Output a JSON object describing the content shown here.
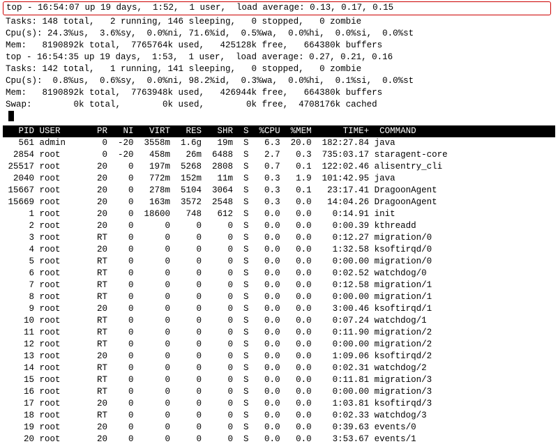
{
  "summary1": {
    "top_line": "top - 16:54:07 up 19 days,  1:52,  1 user,  load average: 0.13, 0.17, 0.15",
    "tasks": "Tasks: 148 total,   2 running, 146 sleeping,   0 stopped,   0 zombie",
    "cpu": "Cpu(s): 24.3%us,  3.6%sy,  0.0%ni, 71.6%id,  0.5%wa,  0.0%hi,  0.0%si,  0.0%st",
    "mem": "Mem:   8190892k total,  7765764k used,   425128k free,   664380k buffers"
  },
  "summary2": {
    "top_line": "top - 16:54:35 up 19 days,  1:53,  1 user,  load average: 0.27, 0.21, 0.16",
    "tasks": "Tasks: 142 total,   1 running, 141 sleeping,   0 stopped,   0 zombie",
    "cpu": "Cpu(s):  0.8%us,  0.6%sy,  0.0%ni, 98.2%id,  0.3%wa,  0.0%hi,  0.1%si,  0.0%st",
    "mem": "Mem:   8190892k total,  7763948k used,   426944k free,   664380k buffers",
    "swap": "Swap:        0k total,        0k used,        0k free,  4708176k cached"
  },
  "columns": [
    "PID",
    "USER",
    "PR",
    "NI",
    "VIRT",
    "RES",
    "SHR",
    "S",
    "%CPU",
    "%MEM",
    "TIME+",
    "COMMAND"
  ],
  "processes": [
    {
      "pid": 561,
      "user": "admin",
      "pr": "0",
      "ni": "-20",
      "virt": "3558m",
      "res": "1.6g",
      "shr": "19m",
      "s": "S",
      "cpu": "6.3",
      "mem": "20.0",
      "time": "182:27.84",
      "cmd": "java"
    },
    {
      "pid": 2854,
      "user": "root",
      "pr": "0",
      "ni": "-20",
      "virt": "458m",
      "res": "26m",
      "shr": "6488",
      "s": "S",
      "cpu": "2.7",
      "mem": "0.3",
      "time": "735:03.17",
      "cmd": "staragent-core"
    },
    {
      "pid": 25517,
      "user": "root",
      "pr": "20",
      "ni": "0",
      "virt": "197m",
      "res": "5268",
      "shr": "2808",
      "s": "S",
      "cpu": "0.7",
      "mem": "0.1",
      "time": "122:02.46",
      "cmd": "alisentry_cli"
    },
    {
      "pid": 2040,
      "user": "root",
      "pr": "20",
      "ni": "0",
      "virt": "772m",
      "res": "152m",
      "shr": "11m",
      "s": "S",
      "cpu": "0.3",
      "mem": "1.9",
      "time": "101:42.95",
      "cmd": "java"
    },
    {
      "pid": 15667,
      "user": "root",
      "pr": "20",
      "ni": "0",
      "virt": "278m",
      "res": "5104",
      "shr": "3064",
      "s": "S",
      "cpu": "0.3",
      "mem": "0.1",
      "time": "23:17.41",
      "cmd": "DragoonAgent"
    },
    {
      "pid": 15669,
      "user": "root",
      "pr": "20",
      "ni": "0",
      "virt": "163m",
      "res": "3572",
      "shr": "2548",
      "s": "S",
      "cpu": "0.3",
      "mem": "0.0",
      "time": "14:04.26",
      "cmd": "DragoonAgent"
    },
    {
      "pid": 1,
      "user": "root",
      "pr": "20",
      "ni": "0",
      "virt": "18600",
      "res": "748",
      "shr": "612",
      "s": "S",
      "cpu": "0.0",
      "mem": "0.0",
      "time": "0:14.91",
      "cmd": "init"
    },
    {
      "pid": 2,
      "user": "root",
      "pr": "20",
      "ni": "0",
      "virt": "0",
      "res": "0",
      "shr": "0",
      "s": "S",
      "cpu": "0.0",
      "mem": "0.0",
      "time": "0:00.39",
      "cmd": "kthreadd"
    },
    {
      "pid": 3,
      "user": "root",
      "pr": "RT",
      "ni": "0",
      "virt": "0",
      "res": "0",
      "shr": "0",
      "s": "S",
      "cpu": "0.0",
      "mem": "0.0",
      "time": "0:12.27",
      "cmd": "migration/0"
    },
    {
      "pid": 4,
      "user": "root",
      "pr": "20",
      "ni": "0",
      "virt": "0",
      "res": "0",
      "shr": "0",
      "s": "S",
      "cpu": "0.0",
      "mem": "0.0",
      "time": "1:32.58",
      "cmd": "ksoftirqd/0"
    },
    {
      "pid": 5,
      "user": "root",
      "pr": "RT",
      "ni": "0",
      "virt": "0",
      "res": "0",
      "shr": "0",
      "s": "S",
      "cpu": "0.0",
      "mem": "0.0",
      "time": "0:00.00",
      "cmd": "migration/0"
    },
    {
      "pid": 6,
      "user": "root",
      "pr": "RT",
      "ni": "0",
      "virt": "0",
      "res": "0",
      "shr": "0",
      "s": "S",
      "cpu": "0.0",
      "mem": "0.0",
      "time": "0:02.52",
      "cmd": "watchdog/0"
    },
    {
      "pid": 7,
      "user": "root",
      "pr": "RT",
      "ni": "0",
      "virt": "0",
      "res": "0",
      "shr": "0",
      "s": "S",
      "cpu": "0.0",
      "mem": "0.0",
      "time": "0:12.58",
      "cmd": "migration/1"
    },
    {
      "pid": 8,
      "user": "root",
      "pr": "RT",
      "ni": "0",
      "virt": "0",
      "res": "0",
      "shr": "0",
      "s": "S",
      "cpu": "0.0",
      "mem": "0.0",
      "time": "0:00.00",
      "cmd": "migration/1"
    },
    {
      "pid": 9,
      "user": "root",
      "pr": "20",
      "ni": "0",
      "virt": "0",
      "res": "0",
      "shr": "0",
      "s": "S",
      "cpu": "0.0",
      "mem": "0.0",
      "time": "3:00.46",
      "cmd": "ksoftirqd/1"
    },
    {
      "pid": 10,
      "user": "root",
      "pr": "RT",
      "ni": "0",
      "virt": "0",
      "res": "0",
      "shr": "0",
      "s": "S",
      "cpu": "0.0",
      "mem": "0.0",
      "time": "0:07.24",
      "cmd": "watchdog/1"
    },
    {
      "pid": 11,
      "user": "root",
      "pr": "RT",
      "ni": "0",
      "virt": "0",
      "res": "0",
      "shr": "0",
      "s": "S",
      "cpu": "0.0",
      "mem": "0.0",
      "time": "0:11.90",
      "cmd": "migration/2"
    },
    {
      "pid": 12,
      "user": "root",
      "pr": "RT",
      "ni": "0",
      "virt": "0",
      "res": "0",
      "shr": "0",
      "s": "S",
      "cpu": "0.0",
      "mem": "0.0",
      "time": "0:00.00",
      "cmd": "migration/2"
    },
    {
      "pid": 13,
      "user": "root",
      "pr": "20",
      "ni": "0",
      "virt": "0",
      "res": "0",
      "shr": "0",
      "s": "S",
      "cpu": "0.0",
      "mem": "0.0",
      "time": "1:09.06",
      "cmd": "ksoftirqd/2"
    },
    {
      "pid": 14,
      "user": "root",
      "pr": "RT",
      "ni": "0",
      "virt": "0",
      "res": "0",
      "shr": "0",
      "s": "S",
      "cpu": "0.0",
      "mem": "0.0",
      "time": "0:02.31",
      "cmd": "watchdog/2"
    },
    {
      "pid": 15,
      "user": "root",
      "pr": "RT",
      "ni": "0",
      "virt": "0",
      "res": "0",
      "shr": "0",
      "s": "S",
      "cpu": "0.0",
      "mem": "0.0",
      "time": "0:11.81",
      "cmd": "migration/3"
    },
    {
      "pid": 16,
      "user": "root",
      "pr": "RT",
      "ni": "0",
      "virt": "0",
      "res": "0",
      "shr": "0",
      "s": "S",
      "cpu": "0.0",
      "mem": "0.0",
      "time": "0:00.00",
      "cmd": "migration/3"
    },
    {
      "pid": 17,
      "user": "root",
      "pr": "20",
      "ni": "0",
      "virt": "0",
      "res": "0",
      "shr": "0",
      "s": "S",
      "cpu": "0.0",
      "mem": "0.0",
      "time": "1:03.81",
      "cmd": "ksoftirqd/3"
    },
    {
      "pid": 18,
      "user": "root",
      "pr": "RT",
      "ni": "0",
      "virt": "0",
      "res": "0",
      "shr": "0",
      "s": "S",
      "cpu": "0.0",
      "mem": "0.0",
      "time": "0:02.33",
      "cmd": "watchdog/3"
    },
    {
      "pid": 19,
      "user": "root",
      "pr": "20",
      "ni": "0",
      "virt": "0",
      "res": "0",
      "shr": "0",
      "s": "S",
      "cpu": "0.0",
      "mem": "0.0",
      "time": "0:39.63",
      "cmd": "events/0"
    },
    {
      "pid": 20,
      "user": "root",
      "pr": "20",
      "ni": "0",
      "virt": "0",
      "res": "0",
      "shr": "0",
      "s": "S",
      "cpu": "0.0",
      "mem": "0.0",
      "time": "3:53.67",
      "cmd": "events/1"
    }
  ]
}
